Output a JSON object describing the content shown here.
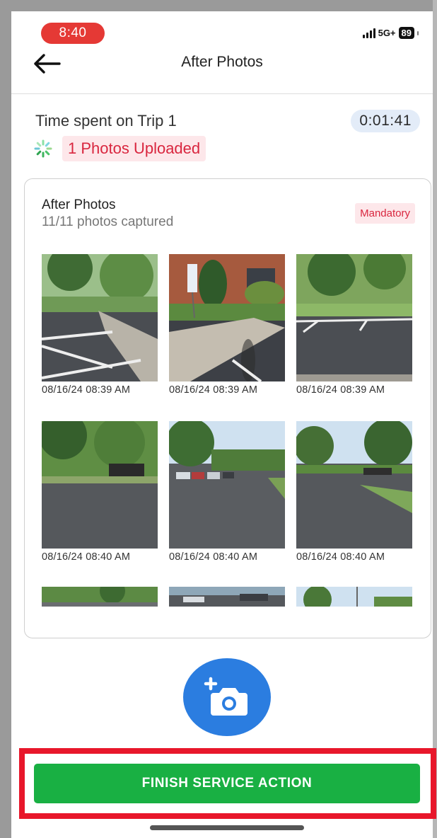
{
  "status_bar": {
    "time": "8:40",
    "network": "5G+",
    "battery": "89"
  },
  "nav": {
    "title": "After Photos",
    "back_icon": "arrow-left-icon"
  },
  "trip": {
    "label": "Time spent on Trip 1",
    "timer": "0:01:41"
  },
  "upload": {
    "icon": "spinner-icon",
    "text": "1 Photos Uploaded"
  },
  "card": {
    "title": "After Photos",
    "subtitle": "11/11 photos captured",
    "badge": "Mandatory"
  },
  "photos": [
    {
      "caption": "08/16/24 08:39 AM"
    },
    {
      "caption": "08/16/24 08:39 AM"
    },
    {
      "caption": "08/16/24 08:39 AM"
    },
    {
      "caption": "08/16/24 08:40 AM"
    },
    {
      "caption": "08/16/24 08:40 AM"
    },
    {
      "caption": "08/16/24 08:40 AM"
    },
    {
      "caption": ""
    },
    {
      "caption": ""
    },
    {
      "caption": ""
    }
  ],
  "camera_button": {
    "icon": "add-camera-icon"
  },
  "finish_button": {
    "label": "FINISH SERVICE ACTION"
  },
  "colors": {
    "time_pill": "#e53935",
    "accent_blue": "#2b7de0",
    "finish_green": "#19b043",
    "highlight_red": "#e8172b",
    "badge_red_text": "#d9263f",
    "badge_red_bg": "#fde7ea",
    "timer_bg": "#e3ecf8"
  }
}
